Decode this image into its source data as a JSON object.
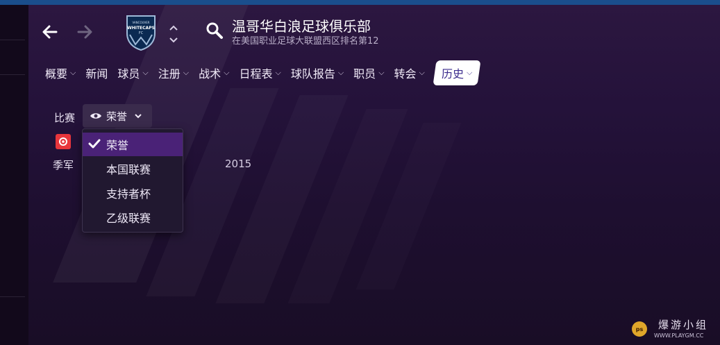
{
  "header": {
    "title": "温哥华白浪足球俱乐部",
    "subtitle": "在美国职业足球大联盟西区排名第12",
    "crest_text": [
      "VANCOUVER",
      "WHITECAPS",
      "FC"
    ]
  },
  "nav": {
    "items": [
      {
        "label": "概要",
        "has_dropdown": true
      },
      {
        "label": "新闻",
        "has_dropdown": false
      },
      {
        "label": "球员",
        "has_dropdown": true
      },
      {
        "label": "注册",
        "has_dropdown": true
      },
      {
        "label": "战术",
        "has_dropdown": true
      },
      {
        "label": "日程表",
        "has_dropdown": true
      },
      {
        "label": "球队报告",
        "has_dropdown": true
      },
      {
        "label": "职员",
        "has_dropdown": true
      },
      {
        "label": "转会",
        "has_dropdown": true
      },
      {
        "label": "历史",
        "has_dropdown": true,
        "active": true
      }
    ]
  },
  "filter": {
    "label": "比赛",
    "selected": "荣誉"
  },
  "dropdown": {
    "options": [
      "荣誉",
      "本国联赛",
      "支持者杯",
      "乙级联赛"
    ],
    "selected_index": 0
  },
  "honours": {
    "row_label": "季军",
    "year": "2015"
  },
  "watermark": {
    "text": "爆游小组",
    "url": "WWW.PLAYGM.CC",
    "badge": "ps"
  },
  "colors": {
    "accent": "#4a2277",
    "top_line": "#1a4e8c",
    "active_tab_text": "#3a2a8c",
    "trophy_red": "#e8363c"
  }
}
